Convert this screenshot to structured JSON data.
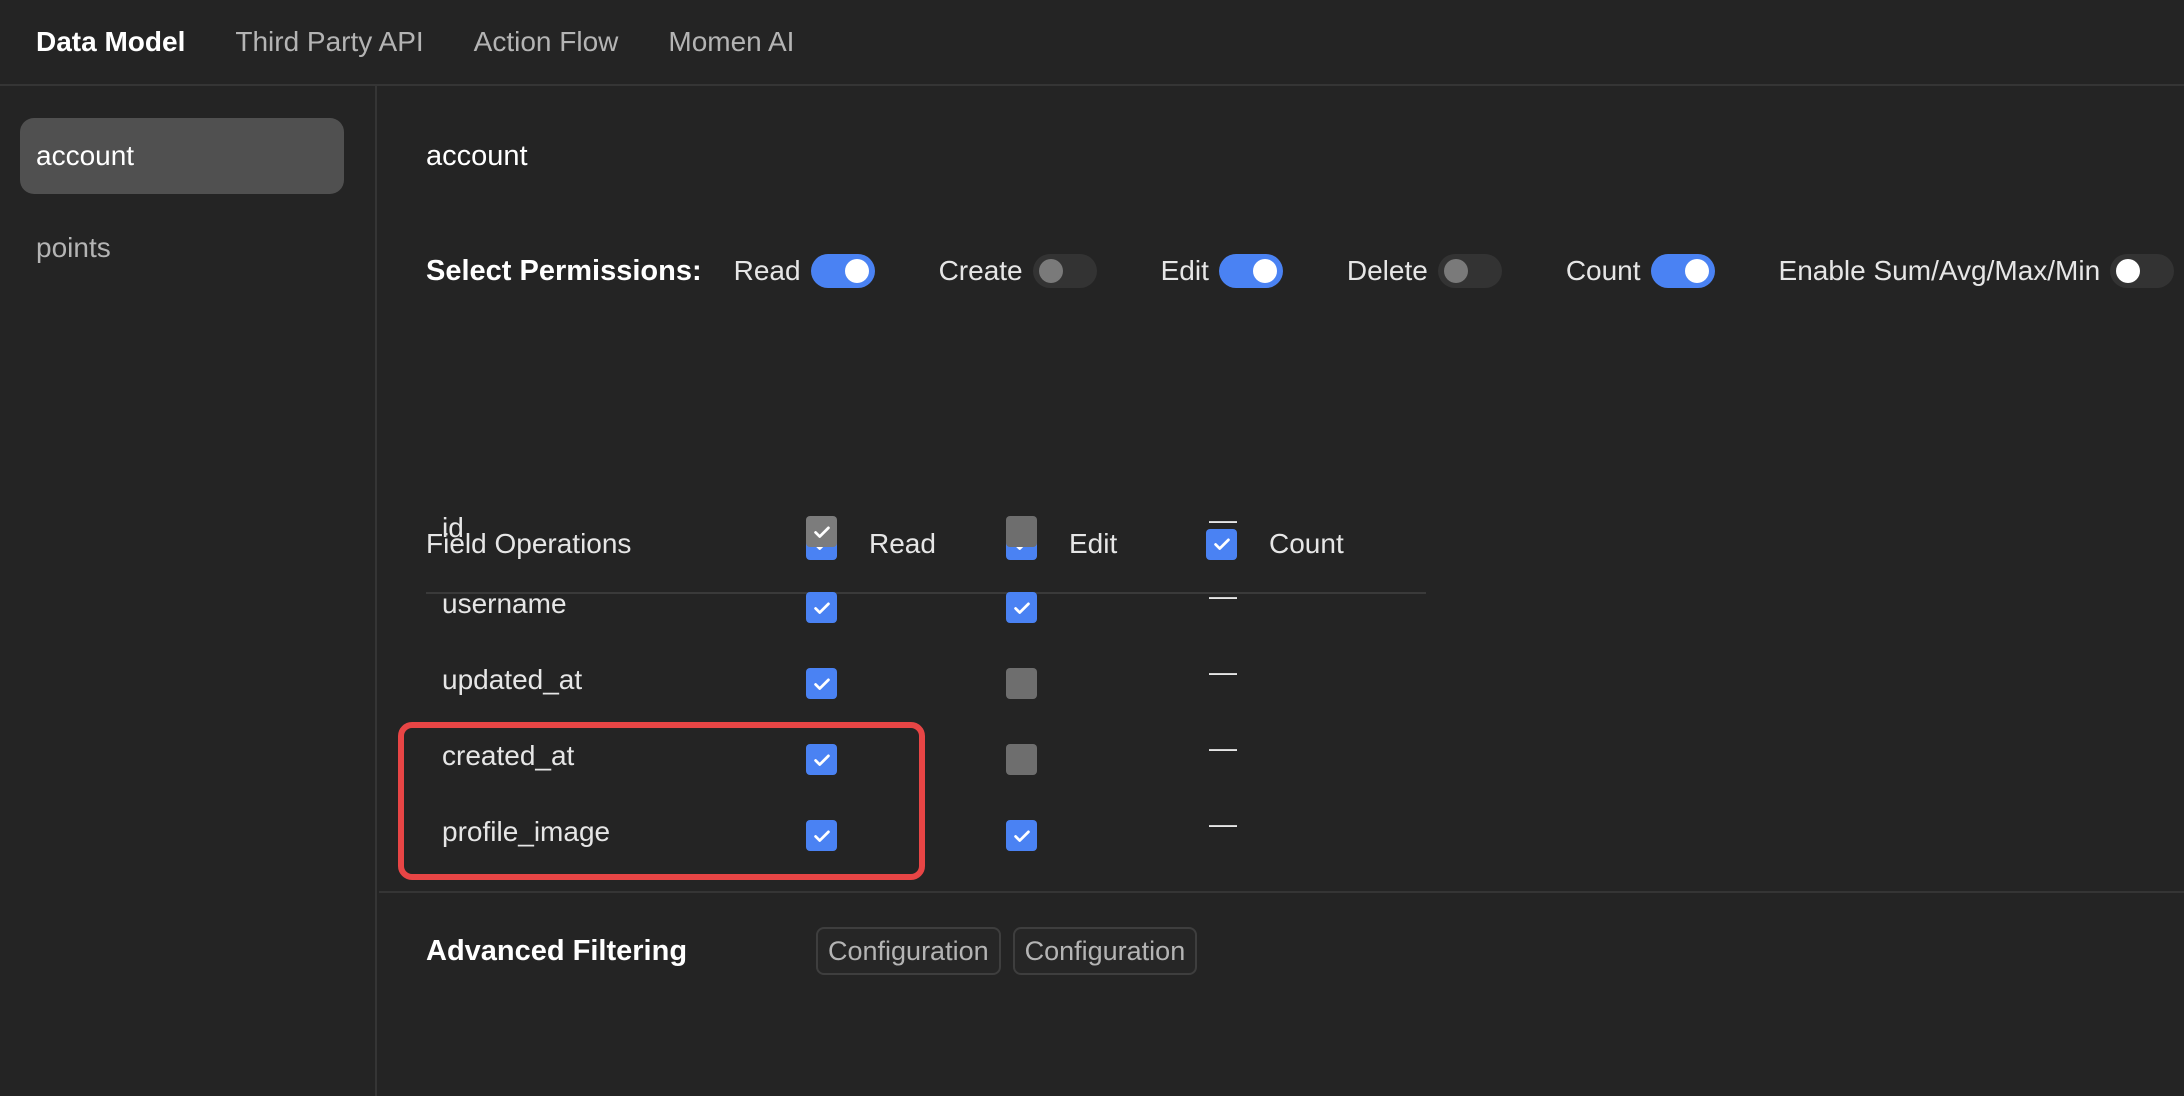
{
  "nav": {
    "tabs": [
      {
        "label": "Data Model",
        "active": true
      },
      {
        "label": "Third Party API",
        "active": false
      },
      {
        "label": "Action Flow",
        "active": false
      },
      {
        "label": "Momen AI",
        "active": false
      }
    ]
  },
  "sidebar": {
    "items": [
      {
        "label": "account",
        "active": true
      },
      {
        "label": "points",
        "active": false
      }
    ]
  },
  "main": {
    "title": "account",
    "permissions": {
      "heading": "Select Permissions:",
      "items": [
        {
          "label": "Read",
          "on": true
        },
        {
          "label": "Create",
          "on": false
        },
        {
          "label": "Edit",
          "on": true
        },
        {
          "label": "Delete",
          "on": false
        },
        {
          "label": "Count",
          "on": true
        },
        {
          "label": "Enable Sum/Avg/Max/Min",
          "on": false
        }
      ]
    },
    "field_table": {
      "heading": "Field Operations",
      "columns": {
        "read": {
          "label": "Read",
          "checked": true
        },
        "edit": {
          "label": "Edit",
          "checked": true
        },
        "count": {
          "label": "Count",
          "checked": true
        }
      },
      "rows": [
        {
          "name": "id",
          "read": "checked-disabled",
          "edit": "unchecked",
          "count": "—"
        },
        {
          "name": "username",
          "read": "checked",
          "edit": "checked",
          "count": "—"
        },
        {
          "name": "updated_at",
          "read": "checked",
          "edit": "unchecked",
          "count": "—"
        },
        {
          "name": "created_at",
          "read": "checked",
          "edit": "unchecked",
          "count": "—"
        },
        {
          "name": "profile_image",
          "read": "checked",
          "edit": "checked",
          "count": "—"
        }
      ]
    },
    "advanced": {
      "label": "Advanced Filtering",
      "buttons": [
        "Configuration",
        "Configuration"
      ]
    }
  },
  "colors": {
    "accent": "#4a82f3",
    "highlight": "#e84545",
    "background": "#242424"
  }
}
